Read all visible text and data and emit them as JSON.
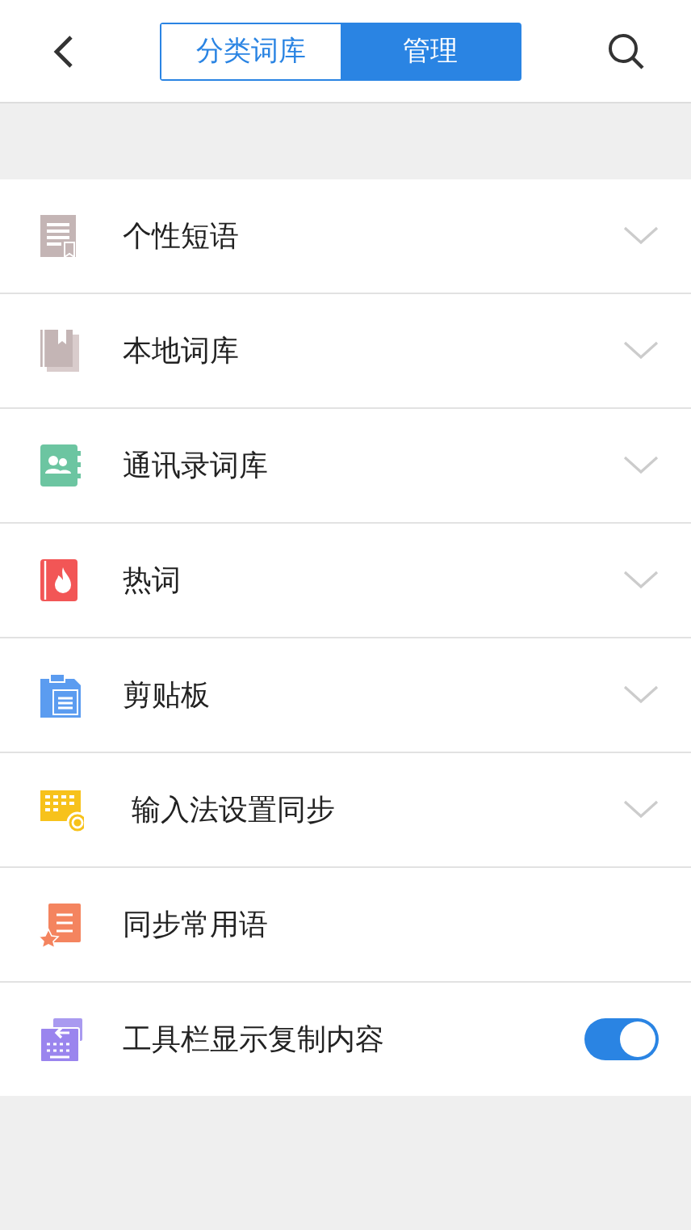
{
  "tabs": [
    {
      "label": "分类词库",
      "selected": false
    },
    {
      "label": "管理",
      "selected": true
    }
  ],
  "items": [
    {
      "kind": "expand",
      "label": "个性短语",
      "expanded": false
    },
    {
      "kind": "expand",
      "label": "本地词库",
      "expanded": false
    },
    {
      "kind": "expand",
      "label": "通讯录词库",
      "expanded": false
    },
    {
      "kind": "expand",
      "label": "热词",
      "expanded": false
    },
    {
      "kind": "expand",
      "label": "剪贴板",
      "expanded": false
    },
    {
      "kind": "expand",
      "label": " 输入法设置同步",
      "expanded": false
    },
    {
      "kind": "plain",
      "label": "同步常用语"
    },
    {
      "kind": "toggle",
      "label": "工具栏显示复制内容",
      "on": true
    }
  ]
}
